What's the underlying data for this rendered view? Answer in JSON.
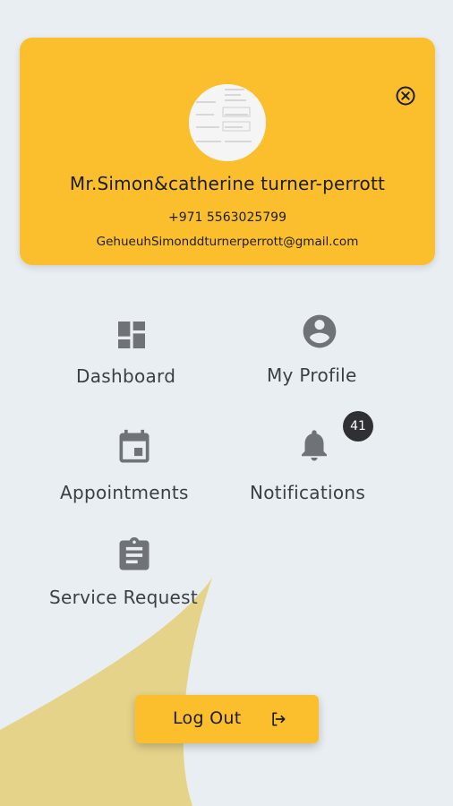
{
  "profile": {
    "name": "Mr.Simon&catherine turner-perrott",
    "phone": "+971 5563025799",
    "email": "GehueuhSimonddturnerperrott@gmail.com"
  },
  "menu": {
    "dashboard": "Dashboard",
    "my_profile": "My Profile",
    "appointments": "Appointments",
    "notifications": "Notifications",
    "service_request": "Service Request"
  },
  "notifications_count": "41",
  "logout_label": "Log Out",
  "colors": {
    "accent": "#fbbf2d",
    "background": "#e9eef2",
    "swoosh": "#e6d38a",
    "icon": "#6f7377",
    "badge": "#2f3033"
  },
  "icons": {
    "close": "close-circle-icon",
    "dashboard": "dashboard-icon",
    "profile": "account-circle-icon",
    "appointments": "calendar-icon",
    "notifications": "bell-icon",
    "service_request": "clipboard-icon",
    "logout": "logout-icon"
  }
}
